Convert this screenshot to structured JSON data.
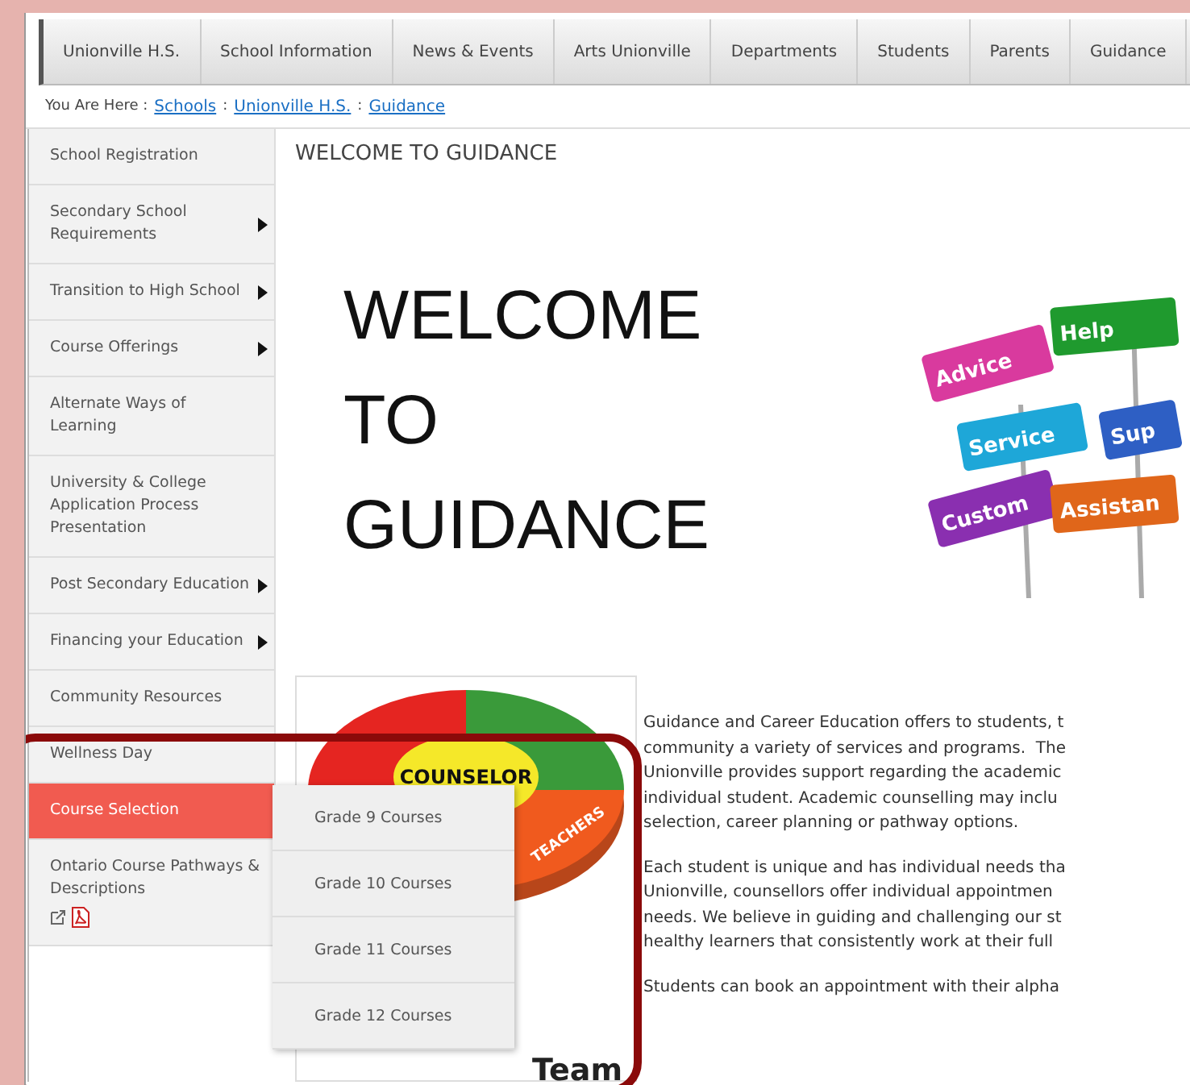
{
  "nav": {
    "tabs": [
      {
        "label": "Unionville H.S.",
        "selected": false
      },
      {
        "label": "School Information",
        "selected": false
      },
      {
        "label": "News & Events",
        "selected": false
      },
      {
        "label": "Arts Unionville",
        "selected": false
      },
      {
        "label": "Departments",
        "selected": false
      },
      {
        "label": "Students",
        "selected": false
      },
      {
        "label": "Parents",
        "selected": false
      },
      {
        "label": "Guidance",
        "selected": false
      }
    ]
  },
  "breadcrumb": {
    "prefix": "You Are Here :",
    "links": [
      "Schools",
      "Unionville H.S.",
      "Guidance"
    ],
    "separator": ":"
  },
  "sidebar": {
    "items": [
      {
        "label": "School Registration",
        "kind": "page",
        "has_submenu": false,
        "selected": false
      },
      {
        "label": "Secondary School Requirements",
        "kind": "page",
        "has_submenu": true,
        "selected": false
      },
      {
        "label": "Transition to High School",
        "kind": "page",
        "has_submenu": true,
        "selected": false
      },
      {
        "label": "Course Offerings",
        "kind": "page",
        "has_submenu": true,
        "selected": false
      },
      {
        "label": "Alternate Ways of Learning",
        "kind": "page",
        "has_submenu": false,
        "selected": false
      },
      {
        "label": "University & College Application Process Presentation",
        "kind": "page",
        "has_submenu": false,
        "selected": false
      },
      {
        "label": "Post Secondary Education",
        "kind": "page",
        "has_submenu": true,
        "selected": false
      },
      {
        "label": "Financing your Education",
        "kind": "page",
        "has_submenu": true,
        "selected": false
      },
      {
        "label": "Community Resources",
        "kind": "page",
        "has_submenu": false,
        "selected": false
      },
      {
        "label": "Wellness Day",
        "kind": "page",
        "has_submenu": false,
        "selected": false
      },
      {
        "label": "Course Selection",
        "kind": "page",
        "has_submenu": true,
        "selected": true
      },
      {
        "label": "Ontario Course Pathways & Descriptions",
        "kind": "document",
        "has_submenu": false,
        "selected": false
      }
    ]
  },
  "submenu": {
    "items": [
      "Grade 9 Courses",
      "Grade 10 Courses",
      "Grade 11 Courses",
      "Grade 12 Courses"
    ]
  },
  "content": {
    "heading": "WELCOME TO GUIDANCE",
    "banner": {
      "lines": [
        "WELCOME",
        "TO",
        "GUIDANCE"
      ],
      "signs": [
        {
          "label": "Advice",
          "color": "#d93a9e"
        },
        {
          "label": "Help",
          "color": "#1f9a2e"
        },
        {
          "label": "Service",
          "color": "#1ea7d8"
        },
        {
          "label": "Sup",
          "color": "#2e5fc4"
        },
        {
          "label": "Custom",
          "color": "#8a2fb0"
        },
        {
          "label": "Assistan",
          "color": "#e0661a"
        }
      ]
    },
    "team_graphic": {
      "center": "COUNSELOR",
      "segments": [
        {
          "label": "TEACHERS",
          "color": "#f05a1e"
        }
      ],
      "caption": "Team"
    },
    "paragraphs": [
      [
        "Guidance and Career Education offers to students, t",
        "community a variety of services and programs.  The",
        "Unionville provides support regarding the academic",
        "individual student. Academic counselling may inclu",
        "selection, career planning or pathway options."
      ],
      [
        "Each student is unique and has individual needs tha",
        "Unionville, counsellors offer individual appointmen",
        "needs. We believe in guiding and challenging our st",
        "healthy learners that consistently work at their full"
      ],
      [
        "Students can book an appointment with their alpha"
      ]
    ]
  },
  "annotation": {
    "color": "#8b0a0a"
  }
}
